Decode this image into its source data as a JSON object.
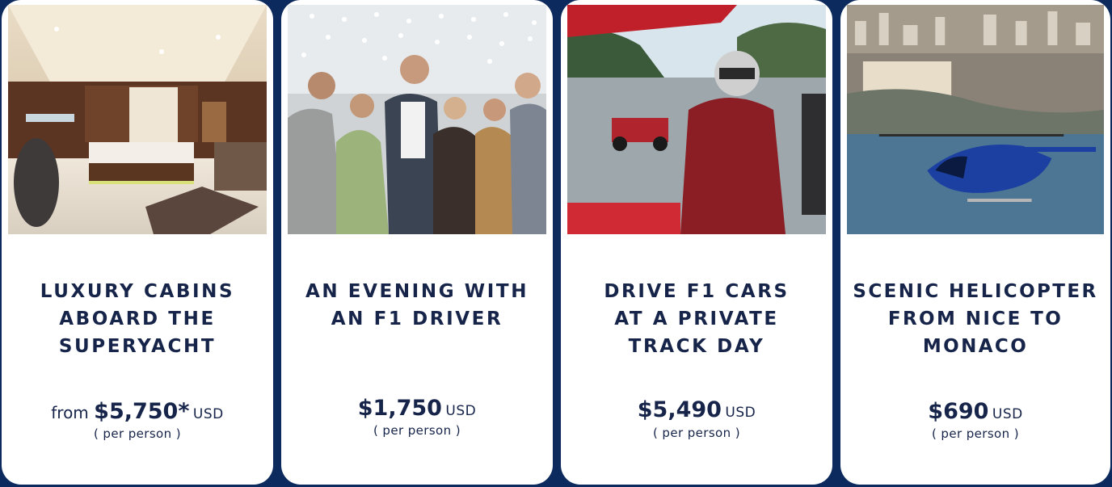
{
  "colors": {
    "background": "#0d2a5e",
    "card": "#ffffff",
    "text": "#16244a"
  },
  "cards": [
    {
      "image_icon": "yacht-cabin-photo",
      "title": "LUXURY CABINS\nABOARD THE\nSUPERYACHT",
      "price_prefix": "from ",
      "price": "$5,750*",
      "currency": "USD",
      "per_person": "( per person )"
    },
    {
      "image_icon": "group-photo",
      "title": "AN EVENING WITH\nAN F1 DRIVER",
      "price_prefix": "",
      "price": "$1,750",
      "currency": "USD",
      "per_person": "( per person )"
    },
    {
      "image_icon": "f1-driver-photo",
      "title": "DRIVE F1 CARS\nAT A PRIVATE\nTRACK DAY",
      "price_prefix": "",
      "price": "$5,490",
      "currency": "USD",
      "per_person": "( per person )"
    },
    {
      "image_icon": "helicopter-monaco-photo",
      "title": "SCENIC HELICOPTER\nFROM NICE TO\nMONACO",
      "price_prefix": "",
      "price": "$690",
      "currency": "USD",
      "per_person": "( per person )"
    }
  ]
}
